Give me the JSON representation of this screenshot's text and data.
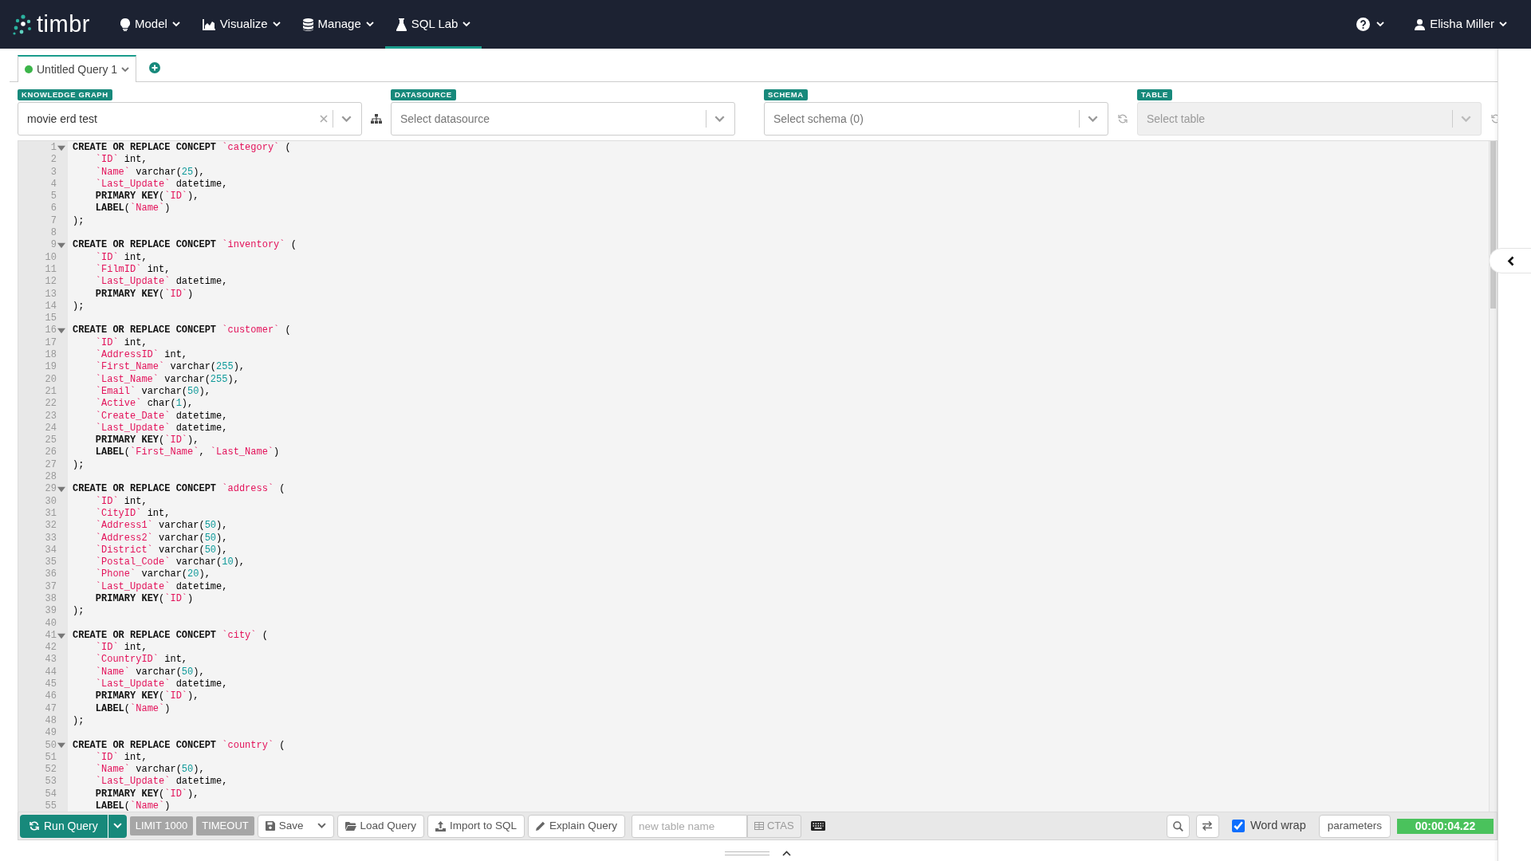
{
  "navbar": {
    "logo": "timbr",
    "menus": [
      {
        "label": "Model",
        "selected": false
      },
      {
        "label": "Visualize",
        "selected": false
      },
      {
        "label": "Manage",
        "selected": false
      },
      {
        "label": "SQL Lab",
        "selected": true
      }
    ],
    "user": "Elisha Miller"
  },
  "query_tabs": [
    {
      "label": "Untitled Query 1",
      "selected": true
    }
  ],
  "selectors": [
    {
      "label": "KNOWLEDGE GRAPH",
      "value": "movie erd test",
      "clearable": true,
      "disabled": false,
      "kind": "hierarchy"
    },
    {
      "label": "DATASOURCE",
      "placeholder": "Select datasource",
      "clearable": false,
      "disabled": false
    },
    {
      "label": "SCHEMA",
      "placeholder": "Select schema (0)",
      "clearable": false,
      "disabled": false,
      "kind": "refresh"
    },
    {
      "label": "TABLE",
      "placeholder": "Select table",
      "clearable": false,
      "disabled": true,
      "kind": "refresh"
    }
  ],
  "editor": {
    "lines": [
      {
        "number": "1",
        "text": "CREATE OR REPLACE CONCEPT `category` (",
        "foldable": true
      },
      {
        "number": "2",
        "text": "    `ID` int,",
        "foldable": false
      },
      {
        "number": "3",
        "text": "    `Name` varchar(25),",
        "foldable": false
      },
      {
        "number": "4",
        "text": "    `Last_Update` datetime,",
        "foldable": false
      },
      {
        "number": "5",
        "text": "    PRIMARY KEY(`ID`),",
        "foldable": false
      },
      {
        "number": "6",
        "text": "    LABEL(`Name`)",
        "foldable": false
      },
      {
        "number": "7",
        "text": ");",
        "foldable": false
      },
      {
        "number": "8",
        "foldable": false
      },
      {
        "number": "9",
        "text": "CREATE OR REPLACE CONCEPT `inventory` (",
        "foldable": true
      },
      {
        "number": "10",
        "text": "    `ID` int,",
        "foldable": false
      },
      {
        "number": "11",
        "text": "    `FilmID` int,",
        "foldable": false
      },
      {
        "number": "12",
        "text": "    `Last_Update` datetime,",
        "foldable": false
      },
      {
        "number": "13",
        "text": "    PRIMARY KEY(`ID`)",
        "foldable": false
      },
      {
        "number": "14",
        "text": ");",
        "foldable": false
      },
      {
        "number": "15",
        "foldable": false
      },
      {
        "number": "16",
        "text": "CREATE OR REPLACE CONCEPT `customer` (",
        "foldable": true
      },
      {
        "number": "17",
        "text": "    `ID` int,",
        "foldable": false
      },
      {
        "number": "18",
        "text": "    `AddressID` int,",
        "foldable": false
      },
      {
        "number": "19",
        "text": "    `First_Name` varchar(255),",
        "foldable": false
      },
      {
        "number": "20",
        "text": "    `Last_Name` varchar(255),",
        "foldable": false
      },
      {
        "number": "21",
        "text": "    `Email` varchar(50),",
        "foldable": false
      },
      {
        "number": "22",
        "text": "    `Active` char(1),",
        "foldable": false
      },
      {
        "number": "23",
        "text": "    `Create_Date` datetime,",
        "foldable": false
      },
      {
        "number": "24",
        "text": "    `Last_Update` datetime,",
        "foldable": false
      },
      {
        "number": "25",
        "text": "    PRIMARY KEY(`ID`),",
        "foldable": false
      },
      {
        "number": "26",
        "text": "    LABEL(`First_Name`, `Last_Name`)",
        "foldable": false
      },
      {
        "number": "27",
        "text": ");",
        "foldable": false
      },
      {
        "number": "28",
        "foldable": false
      },
      {
        "number": "29",
        "text": "CREATE OR REPLACE CONCEPT `address` (",
        "foldable": true
      },
      {
        "number": "30",
        "text": "    `ID` int,",
        "foldable": false
      },
      {
        "number": "31",
        "text": "    `CityID` int,",
        "foldable": false
      },
      {
        "number": "32",
        "text": "    `Address1` varchar(50),",
        "foldable": false
      },
      {
        "number": "33",
        "text": "    `Address2` varchar(50),",
        "foldable": false
      },
      {
        "number": "34",
        "text": "    `District` varchar(50),",
        "foldable": false
      },
      {
        "number": "35",
        "text": "    `Postal_Code` varchar(10),",
        "foldable": false
      },
      {
        "number": "36",
        "text": "    `Phone` varchar(20),",
        "foldable": false
      },
      {
        "number": "37",
        "text": "    `Last_Update` datetime,",
        "foldable": false
      },
      {
        "number": "38",
        "text": "    PRIMARY KEY(`ID`)",
        "foldable": false
      },
      {
        "number": "39",
        "text": ");",
        "foldable": false
      },
      {
        "number": "40",
        "foldable": false
      },
      {
        "number": "41",
        "text": "CREATE OR REPLACE CONCEPT `city` (",
        "foldable": true
      },
      {
        "number": "42",
        "text": "    `ID` int,",
        "foldable": false
      },
      {
        "number": "43",
        "text": "    `CountryID` int,",
        "foldable": false
      },
      {
        "number": "44",
        "text": "    `Name` varchar(50),",
        "foldable": false
      },
      {
        "number": "45",
        "text": "    `Last_Update` datetime,",
        "foldable": false
      },
      {
        "number": "46",
        "text": "    PRIMARY KEY(`ID`),",
        "foldable": false
      },
      {
        "number": "47",
        "text": "    LABEL(`Name`)",
        "foldable": false
      },
      {
        "number": "48",
        "text": ");",
        "foldable": false
      },
      {
        "number": "49",
        "foldable": false
      },
      {
        "number": "50",
        "text": "CREATE OR REPLACE CONCEPT `country` (",
        "foldable": true
      },
      {
        "number": "51",
        "text": "    `ID` int,",
        "foldable": false
      },
      {
        "number": "52",
        "text": "    `Name` varchar(50),",
        "foldable": false
      },
      {
        "number": "53",
        "text": "    `Last_Update` datetime,",
        "foldable": false
      },
      {
        "number": "54",
        "text": "    PRIMARY KEY(`ID`),",
        "foldable": false
      },
      {
        "number": "55",
        "text": "    LABEL(`Name`)",
        "foldable": false
      }
    ]
  },
  "toolbar": {
    "run": "Run Query",
    "limit": "LIMIT 1000",
    "timeout": "TIMEOUT",
    "save": "Save",
    "load": "Load Query",
    "import": "Import to SQL",
    "explain": "Explain Query",
    "table_name": {
      "placeholder": "new table name"
    },
    "ctas": "CTAS",
    "word_wrap": {
      "label": "Word wrap",
      "checked": true
    },
    "parameters": "parameters",
    "timer": "00:00:04.22"
  }
}
